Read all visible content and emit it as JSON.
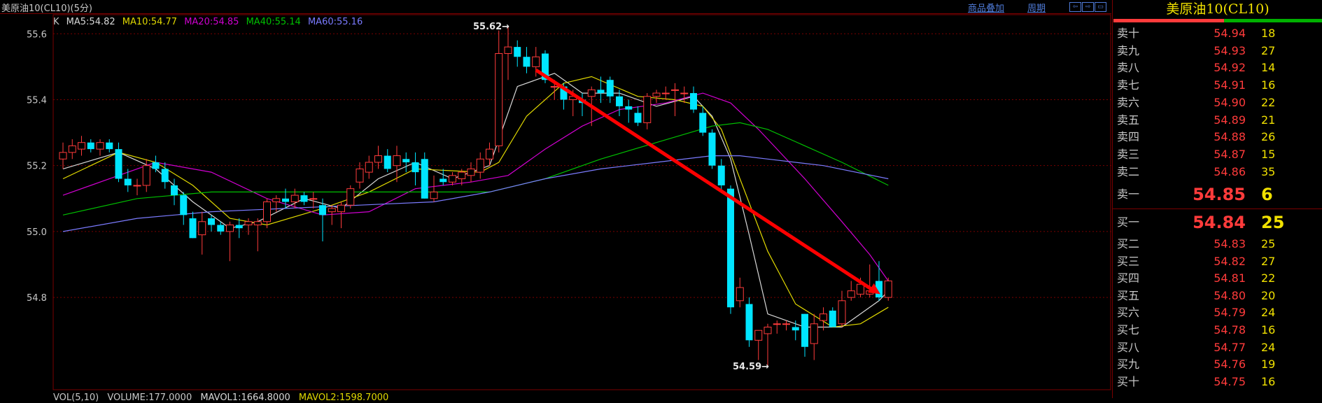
{
  "window": {
    "title": "美原油10(CL10)(5分)",
    "link_add_product": "商品叠加",
    "link_period": "周期",
    "nav_icons": [
      "arrow-left-icon",
      "arrow-right-icon",
      "expand-icon"
    ]
  },
  "colors": {
    "background": "#000000",
    "up": "#ff3b3b",
    "down": "#00e5ff",
    "ma5": "#d8d8d8",
    "ma10": "#e0d800",
    "ma20": "#d000d0",
    "ma40": "#00c000",
    "ma60": "#7b7bff",
    "arrow": "#ff0000",
    "grid": "#7a0000"
  },
  "legend": {
    "k": "K",
    "ma5": "MA5:54.82",
    "ma10": "MA10:54.77",
    "ma20": "MA20:54.85",
    "ma40": "MA40:55.14",
    "ma60": "MA60:55.16"
  },
  "volume_legend": {
    "vol": "VOL(5,10)",
    "volume": "VOLUME:177.0000",
    "mavol1": "MAVOL1:1664.8000",
    "mavol2": "MAVOL2:1598.7000"
  },
  "chart_data": {
    "type": "candlestick",
    "y_ticks": [
      "55.6",
      "55.4",
      "55.2",
      "55.0",
      "54.8"
    ],
    "ylim": [
      54.52,
      55.66
    ],
    "annotations": {
      "high": "55.62",
      "low": "54.59"
    },
    "candles": [
      {
        "o": 55.22,
        "h": 55.27,
        "l": 55.19,
        "c": 55.24
      },
      {
        "o": 55.24,
        "h": 55.28,
        "l": 55.22,
        "c": 55.26
      },
      {
        "o": 55.25,
        "h": 55.29,
        "l": 55.23,
        "c": 55.27
      },
      {
        "o": 55.27,
        "h": 55.28,
        "l": 55.24,
        "c": 55.25
      },
      {
        "o": 55.25,
        "h": 55.28,
        "l": 55.23,
        "c": 55.27
      },
      {
        "o": 55.27,
        "h": 55.28,
        "l": 55.24,
        "c": 55.25
      },
      {
        "o": 55.25,
        "h": 55.27,
        "l": 55.15,
        "c": 55.16
      },
      {
        "o": 55.16,
        "h": 55.19,
        "l": 55.12,
        "c": 55.14
      },
      {
        "o": 55.14,
        "h": 55.16,
        "l": 55.11,
        "c": 55.14
      },
      {
        "o": 55.14,
        "h": 55.22,
        "l": 55.12,
        "c": 55.2
      },
      {
        "o": 55.21,
        "h": 55.23,
        "l": 55.18,
        "c": 55.19
      },
      {
        "o": 55.19,
        "h": 55.21,
        "l": 55.13,
        "c": 55.15
      },
      {
        "o": 55.14,
        "h": 55.16,
        "l": 55.08,
        "c": 55.11
      },
      {
        "o": 55.11,
        "h": 55.12,
        "l": 55.02,
        "c": 55.05
      },
      {
        "o": 55.04,
        "h": 55.06,
        "l": 54.98,
        "c": 54.98
      },
      {
        "o": 54.99,
        "h": 55.06,
        "l": 54.93,
        "c": 55.03
      },
      {
        "o": 55.04,
        "h": 55.05,
        "l": 55.0,
        "c": 55.02
      },
      {
        "o": 55.02,
        "h": 55.03,
        "l": 54.99,
        "c": 55.0
      },
      {
        "o": 55.0,
        "h": 55.03,
        "l": 54.91,
        "c": 55.02
      },
      {
        "o": 55.02,
        "h": 55.04,
        "l": 54.98,
        "c": 55.01
      },
      {
        "o": 55.02,
        "h": 55.04,
        "l": 54.99,
        "c": 55.03
      },
      {
        "o": 55.02,
        "h": 55.04,
        "l": 54.94,
        "c": 55.03
      },
      {
        "o": 55.03,
        "h": 55.1,
        "l": 55.01,
        "c": 55.09
      },
      {
        "o": 55.09,
        "h": 55.11,
        "l": 55.06,
        "c": 55.1
      },
      {
        "o": 55.1,
        "h": 55.13,
        "l": 55.07,
        "c": 55.09
      },
      {
        "o": 55.09,
        "h": 55.13,
        "l": 55.07,
        "c": 55.11
      },
      {
        "o": 55.11,
        "h": 55.12,
        "l": 55.08,
        "c": 55.09
      },
      {
        "o": 55.1,
        "h": 55.12,
        "l": 55.07,
        "c": 55.1
      },
      {
        "o": 55.08,
        "h": 55.1,
        "l": 54.97,
        "c": 55.05
      },
      {
        "o": 55.06,
        "h": 55.08,
        "l": 55.02,
        "c": 55.07
      },
      {
        "o": 55.06,
        "h": 55.09,
        "l": 55.01,
        "c": 55.08
      },
      {
        "o": 55.08,
        "h": 55.14,
        "l": 55.07,
        "c": 55.13
      },
      {
        "o": 55.15,
        "h": 55.21,
        "l": 55.13,
        "c": 55.19
      },
      {
        "o": 55.18,
        "h": 55.23,
        "l": 55.16,
        "c": 55.21
      },
      {
        "o": 55.21,
        "h": 55.26,
        "l": 55.19,
        "c": 55.23
      },
      {
        "o": 55.23,
        "h": 55.25,
        "l": 55.18,
        "c": 55.19
      },
      {
        "o": 55.2,
        "h": 55.26,
        "l": 55.15,
        "c": 55.23
      },
      {
        "o": 55.22,
        "h": 55.24,
        "l": 55.18,
        "c": 55.21
      },
      {
        "o": 55.21,
        "h": 55.24,
        "l": 55.14,
        "c": 55.18
      },
      {
        "o": 55.22,
        "h": 55.24,
        "l": 55.1,
        "c": 55.1
      },
      {
        "o": 55.1,
        "h": 55.17,
        "l": 55.09,
        "c": 55.12
      },
      {
        "o": 55.16,
        "h": 55.19,
        "l": 55.14,
        "c": 55.15
      },
      {
        "o": 55.15,
        "h": 55.18,
        "l": 55.14,
        "c": 55.17
      },
      {
        "o": 55.16,
        "h": 55.19,
        "l": 55.14,
        "c": 55.18
      },
      {
        "o": 55.17,
        "h": 55.21,
        "l": 55.15,
        "c": 55.19
      },
      {
        "o": 55.18,
        "h": 55.24,
        "l": 55.16,
        "c": 55.22
      },
      {
        "o": 55.22,
        "h": 55.27,
        "l": 55.2,
        "c": 55.25
      },
      {
        "o": 55.26,
        "h": 55.61,
        "l": 55.24,
        "c": 55.54
      },
      {
        "o": 55.54,
        "h": 55.62,
        "l": 55.46,
        "c": 55.56
      },
      {
        "o": 55.56,
        "h": 55.58,
        "l": 55.5,
        "c": 55.53
      },
      {
        "o": 55.53,
        "h": 55.56,
        "l": 55.48,
        "c": 55.5
      },
      {
        "o": 55.5,
        "h": 55.56,
        "l": 55.47,
        "c": 55.53
      },
      {
        "o": 55.54,
        "h": 55.55,
        "l": 55.45,
        "c": 55.46
      },
      {
        "o": 55.44,
        "h": 55.46,
        "l": 55.4,
        "c": 55.44
      },
      {
        "o": 55.44,
        "h": 55.45,
        "l": 55.37,
        "c": 55.4
      },
      {
        "o": 55.4,
        "h": 55.43,
        "l": 55.35,
        "c": 55.41
      },
      {
        "o": 55.4,
        "h": 55.42,
        "l": 55.35,
        "c": 55.39
      },
      {
        "o": 55.41,
        "h": 55.44,
        "l": 55.32,
        "c": 55.43
      },
      {
        "o": 55.43,
        "h": 55.47,
        "l": 55.39,
        "c": 55.42
      },
      {
        "o": 55.46,
        "h": 55.47,
        "l": 55.39,
        "c": 55.41
      },
      {
        "o": 55.41,
        "h": 55.43,
        "l": 55.35,
        "c": 55.38
      },
      {
        "o": 55.38,
        "h": 55.4,
        "l": 55.33,
        "c": 55.37
      },
      {
        "o": 55.36,
        "h": 55.38,
        "l": 55.32,
        "c": 55.33
      },
      {
        "o": 55.33,
        "h": 55.42,
        "l": 55.31,
        "c": 55.41
      },
      {
        "o": 55.41,
        "h": 55.43,
        "l": 55.39,
        "c": 55.42
      },
      {
        "o": 55.42,
        "h": 55.44,
        "l": 55.4,
        "c": 55.42
      },
      {
        "o": 55.43,
        "h": 55.45,
        "l": 55.35,
        "c": 55.43
      },
      {
        "o": 55.42,
        "h": 55.44,
        "l": 55.39,
        "c": 55.42
      },
      {
        "o": 55.42,
        "h": 55.44,
        "l": 55.36,
        "c": 55.37
      },
      {
        "o": 55.36,
        "h": 55.38,
        "l": 55.29,
        "c": 55.3
      },
      {
        "o": 55.3,
        "h": 55.31,
        "l": 55.19,
        "c": 55.2
      },
      {
        "o": 55.2,
        "h": 55.22,
        "l": 55.12,
        "c": 55.14
      },
      {
        "o": 55.13,
        "h": 55.14,
        "l": 54.75,
        "c": 54.77
      },
      {
        "o": 54.79,
        "h": 54.86,
        "l": 54.77,
        "c": 54.83
      },
      {
        "o": 54.78,
        "h": 54.8,
        "l": 54.65,
        "c": 54.67
      },
      {
        "o": 54.67,
        "h": 54.7,
        "l": 54.61,
        "c": 54.7
      },
      {
        "o": 54.69,
        "h": 54.72,
        "l": 54.59,
        "c": 54.71
      },
      {
        "o": 54.72,
        "h": 54.73,
        "l": 54.69,
        "c": 54.72
      },
      {
        "o": 54.72,
        "h": 54.73,
        "l": 54.7,
        "c": 54.72
      },
      {
        "o": 54.71,
        "h": 54.73,
        "l": 54.67,
        "c": 54.7
      },
      {
        "o": 54.75,
        "h": 54.75,
        "l": 54.62,
        "c": 54.65
      },
      {
        "o": 54.66,
        "h": 54.75,
        "l": 54.61,
        "c": 54.72
      },
      {
        "o": 54.73,
        "h": 54.77,
        "l": 54.7,
        "c": 54.75
      },
      {
        "o": 54.76,
        "h": 54.77,
        "l": 54.71,
        "c": 54.71
      },
      {
        "o": 54.72,
        "h": 54.82,
        "l": 54.71,
        "c": 54.79
      },
      {
        "o": 54.8,
        "h": 54.85,
        "l": 54.79,
        "c": 54.82
      },
      {
        "o": 54.81,
        "h": 54.86,
        "l": 54.8,
        "c": 54.84
      },
      {
        "o": 54.81,
        "h": 54.9,
        "l": 54.8,
        "c": 54.82
      },
      {
        "o": 54.85,
        "h": 54.91,
        "l": 54.79,
        "c": 54.8
      },
      {
        "o": 54.8,
        "h": 54.86,
        "l": 54.79,
        "c": 54.85
      }
    ],
    "ma_series": [
      {
        "name": "MA5",
        "points": [
          [
            0,
            55.19
          ],
          [
            6,
            55.24
          ],
          [
            10,
            55.19
          ],
          [
            14,
            55.09
          ],
          [
            18,
            55.01
          ],
          [
            21,
            55.03
          ],
          [
            26,
            55.1
          ],
          [
            30,
            55.07
          ],
          [
            34,
            55.16
          ],
          [
            38,
            55.21
          ],
          [
            42,
            55.16
          ],
          [
            46,
            55.2
          ],
          [
            47,
            55.28
          ],
          [
            49,
            55.44
          ],
          [
            53,
            55.48
          ],
          [
            56,
            55.42
          ],
          [
            60,
            55.42
          ],
          [
            64,
            55.38
          ],
          [
            68,
            55.41
          ],
          [
            70,
            55.35
          ],
          [
            72,
            55.22
          ],
          [
            74,
            54.99
          ],
          [
            76,
            54.75
          ],
          [
            80,
            54.71
          ],
          [
            84,
            54.71
          ],
          [
            88,
            54.79
          ],
          [
            89,
            54.82
          ]
        ]
      },
      {
        "name": "MA10",
        "points": [
          [
            0,
            55.16
          ],
          [
            6,
            55.24
          ],
          [
            10,
            55.21
          ],
          [
            14,
            55.14
          ],
          [
            18,
            55.04
          ],
          [
            22,
            55.02
          ],
          [
            28,
            55.07
          ],
          [
            33,
            55.12
          ],
          [
            38,
            55.19
          ],
          [
            45,
            55.18
          ],
          [
            47,
            55.21
          ],
          [
            50,
            55.35
          ],
          [
            54,
            55.45
          ],
          [
            57,
            55.47
          ],
          [
            62,
            55.41
          ],
          [
            66,
            55.4
          ],
          [
            69,
            55.38
          ],
          [
            71,
            55.31
          ],
          [
            73,
            55.16
          ],
          [
            76,
            54.94
          ],
          [
            79,
            54.78
          ],
          [
            83,
            54.71
          ],
          [
            86,
            54.72
          ],
          [
            89,
            54.77
          ]
        ]
      },
      {
        "name": "MA20",
        "points": [
          [
            0,
            55.11
          ],
          [
            6,
            55.17
          ],
          [
            10,
            55.21
          ],
          [
            16,
            55.18
          ],
          [
            22,
            55.1
          ],
          [
            28,
            55.05
          ],
          [
            33,
            55.06
          ],
          [
            38,
            55.13
          ],
          [
            44,
            55.15
          ],
          [
            48,
            55.17
          ],
          [
            52,
            55.25
          ],
          [
            56,
            55.32
          ],
          [
            60,
            55.37
          ],
          [
            65,
            55.39
          ],
          [
            69,
            55.42
          ],
          [
            72,
            55.39
          ],
          [
            75,
            55.31
          ],
          [
            80,
            55.16
          ],
          [
            84,
            55.03
          ],
          [
            87,
            54.93
          ],
          [
            89,
            54.85
          ]
        ]
      },
      {
        "name": "MA40",
        "points": [
          [
            0,
            55.05
          ],
          [
            8,
            55.1
          ],
          [
            16,
            55.12
          ],
          [
            24,
            55.12
          ],
          [
            32,
            55.12
          ],
          [
            40,
            55.12
          ],
          [
            46,
            55.12
          ],
          [
            52,
            55.16
          ],
          [
            58,
            55.22
          ],
          [
            64,
            55.27
          ],
          [
            70,
            55.32
          ],
          [
            73,
            55.33
          ],
          [
            76,
            55.31
          ],
          [
            80,
            55.26
          ],
          [
            84,
            55.21
          ],
          [
            89,
            55.14
          ]
        ]
      },
      {
        "name": "MA60",
        "points": [
          [
            0,
            55.0
          ],
          [
            8,
            55.04
          ],
          [
            16,
            55.06
          ],
          [
            24,
            55.07
          ],
          [
            32,
            55.08
          ],
          [
            40,
            55.09
          ],
          [
            46,
            55.12
          ],
          [
            52,
            55.16
          ],
          [
            58,
            55.19
          ],
          [
            64,
            55.21
          ],
          [
            70,
            55.23
          ],
          [
            73,
            55.23
          ],
          [
            76,
            55.22
          ],
          [
            82,
            55.2
          ],
          [
            89,
            55.16
          ]
        ]
      }
    ]
  },
  "orderbook": {
    "title": "美原油10(CL10)",
    "asks": [
      {
        "label": "卖十",
        "price": "54.94",
        "vol": "18"
      },
      {
        "label": "卖九",
        "price": "54.93",
        "vol": "27"
      },
      {
        "label": "卖八",
        "price": "54.92",
        "vol": "14"
      },
      {
        "label": "卖七",
        "price": "54.91",
        "vol": "16"
      },
      {
        "label": "卖六",
        "price": "54.90",
        "vol": "22"
      },
      {
        "label": "卖五",
        "price": "54.89",
        "vol": "21"
      },
      {
        "label": "卖四",
        "price": "54.88",
        "vol": "26"
      },
      {
        "label": "卖三",
        "price": "54.87",
        "vol": "15"
      },
      {
        "label": "卖二",
        "price": "54.86",
        "vol": "35"
      },
      {
        "label": "卖一",
        "price": "54.85",
        "vol": "6"
      }
    ],
    "bids": [
      {
        "label": "买一",
        "price": "54.84",
        "vol": "25"
      },
      {
        "label": "买二",
        "price": "54.83",
        "vol": "25"
      },
      {
        "label": "买三",
        "price": "54.82",
        "vol": "27"
      },
      {
        "label": "买四",
        "price": "54.81",
        "vol": "22"
      },
      {
        "label": "买五",
        "price": "54.80",
        "vol": "20"
      },
      {
        "label": "买六",
        "price": "54.79",
        "vol": "24"
      },
      {
        "label": "买七",
        "price": "54.78",
        "vol": "16"
      },
      {
        "label": "买八",
        "price": "54.77",
        "vol": "24"
      },
      {
        "label": "买九",
        "price": "54.76",
        "vol": "19"
      },
      {
        "label": "买十",
        "price": "54.75",
        "vol": "16"
      }
    ]
  }
}
